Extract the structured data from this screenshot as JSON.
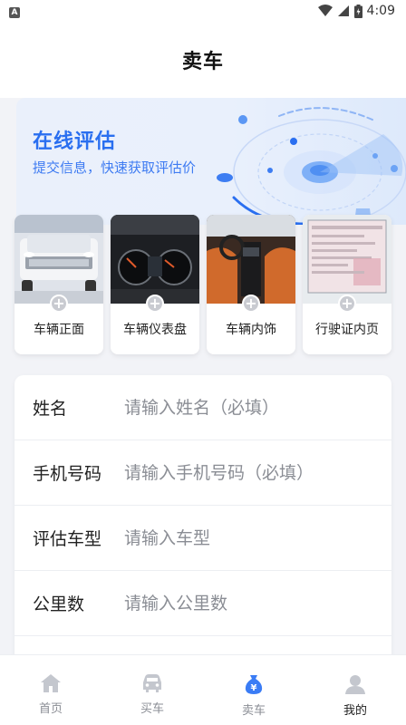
{
  "status_bar": {
    "left_badge": "A",
    "time": "4:09",
    "icons": [
      "wifi-icon",
      "signal-icon",
      "battery-icon"
    ]
  },
  "header": {
    "title": "卖车"
  },
  "hero": {
    "title": "在线评估",
    "subtitle": "提交信息，快速获取评估价",
    "accent_color": "#2a6ff0"
  },
  "photos": [
    {
      "label": "车辆正面",
      "add_icon": "+"
    },
    {
      "label": "车辆仪表盘",
      "add_icon": "+"
    },
    {
      "label": "车辆内饰",
      "add_icon": "+"
    },
    {
      "label": "行驶证内页",
      "add_icon": "+"
    }
  ],
  "form": {
    "fields": [
      {
        "label": "姓名",
        "placeholder": "请输入姓名（必填）",
        "value": ""
      },
      {
        "label": "手机号码",
        "placeholder": "请输入手机号码（必填）",
        "value": ""
      },
      {
        "label": "评估车型",
        "placeholder": "请输入车型",
        "value": ""
      },
      {
        "label": "公里数",
        "placeholder": "请输入公里数",
        "value": ""
      }
    ]
  },
  "tabbar": {
    "items": [
      {
        "label": "首页",
        "icon": "home-icon"
      },
      {
        "label": "买车",
        "icon": "car-icon"
      },
      {
        "label": "卖车",
        "icon": "money-bag-icon",
        "active": true
      },
      {
        "label": "我的",
        "icon": "user-icon"
      }
    ],
    "active_color": "#3a7cf5",
    "inactive_color": "#c4c7ce"
  }
}
